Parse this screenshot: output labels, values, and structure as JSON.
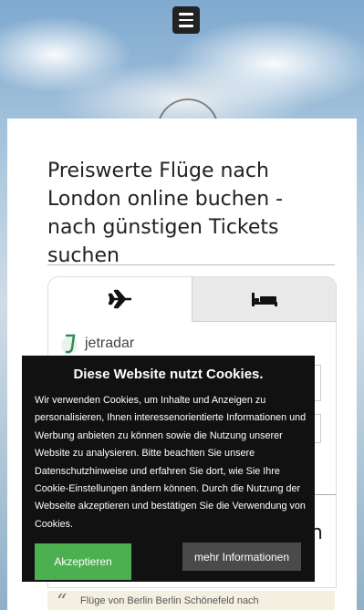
{
  "header": {
    "menu_icon": "hamburger-icon"
  },
  "page": {
    "title": "Preiswerte Flüge nach London online buchen - nach günstigen Tickets suchen"
  },
  "widget": {
    "tabs": [
      {
        "icon": "airplane-icon"
      },
      {
        "icon": "bed-icon"
      }
    ],
    "provider": "jetradar",
    "side_letter": "n"
  },
  "cookie_banner": {
    "title": "Diese Website nutzt Cookies.",
    "text": "Wir verwenden Cookies, um Inhalte und Anzeigen zu personalisieren, Ihnen interessenorientierte Informationen und Werbung anbieten zu können sowie die Nutzung unserer Website zu analysieren. Bitte beachten Sie unsere Datenschutzhinweise und erfahren Sie dort, wie Sie Ihre Cookie-Einstellungen ändern können. Durch die Nutzung der Webseite akzeptieren und bestätigen Sie die Verwendung von Cookies.",
    "accept_label": "Akzeptieren",
    "more_label": "mehr Informationen",
    "accept_color": "#4caf50"
  },
  "quote": {
    "text": "Flüge von Berlin Berlin Schönefeld nach"
  }
}
